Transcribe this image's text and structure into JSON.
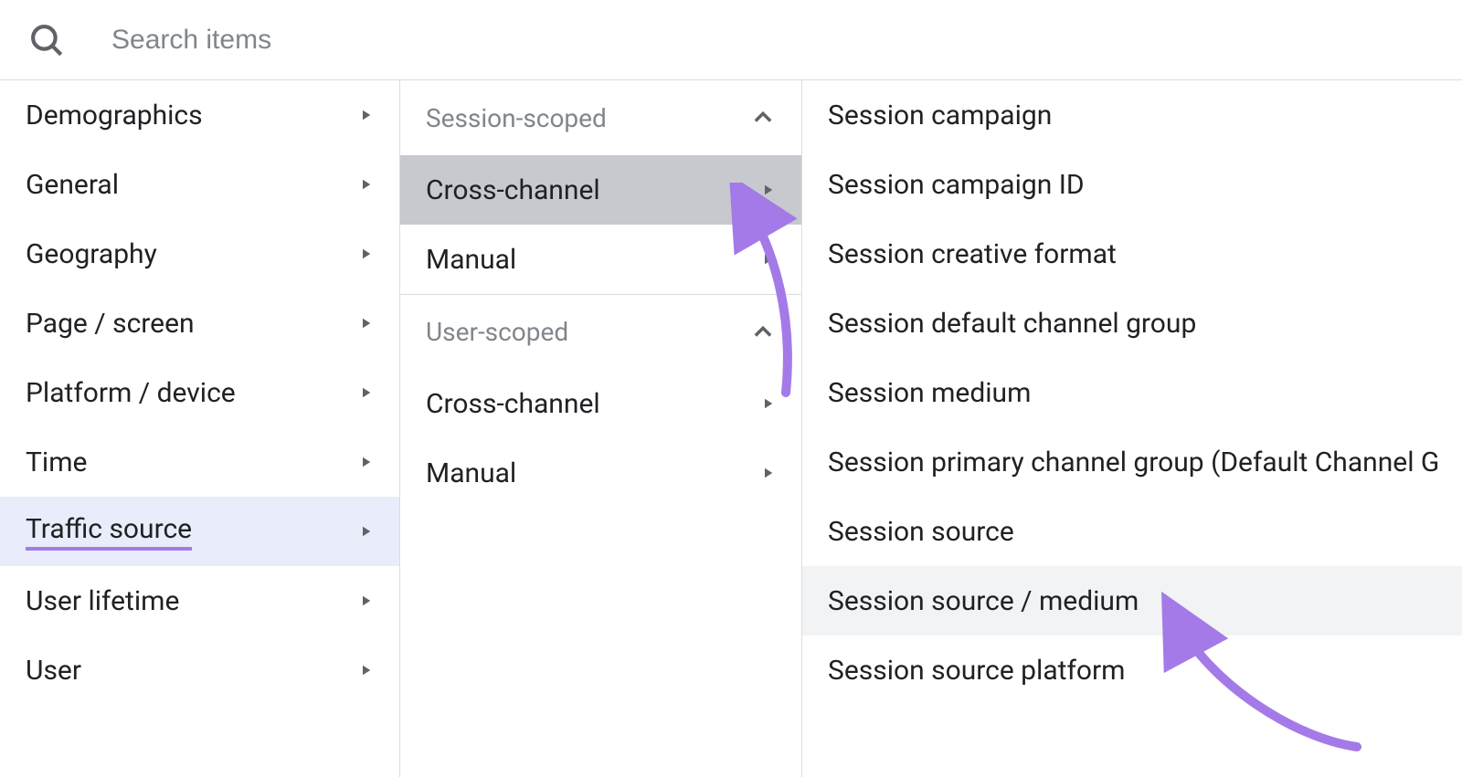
{
  "search": {
    "placeholder": "Search items"
  },
  "col1": {
    "items": [
      {
        "label": "Demographics",
        "selected": false
      },
      {
        "label": "General",
        "selected": false
      },
      {
        "label": "Geography",
        "selected": false
      },
      {
        "label": "Page / screen",
        "selected": false
      },
      {
        "label": "Platform / device",
        "selected": false
      },
      {
        "label": "Time",
        "selected": false
      },
      {
        "label": "Traffic source",
        "selected": true
      },
      {
        "label": "User lifetime",
        "selected": false
      },
      {
        "label": "User",
        "selected": false
      }
    ]
  },
  "col2": {
    "groups": [
      {
        "title": "Session-scoped",
        "items": [
          {
            "label": "Cross-channel",
            "selected": true
          },
          {
            "label": "Manual",
            "selected": false
          }
        ]
      },
      {
        "title": "User-scoped",
        "items": [
          {
            "label": "Cross-channel",
            "selected": false
          },
          {
            "label": "Manual",
            "selected": false
          }
        ]
      }
    ]
  },
  "col3": {
    "items": [
      {
        "label": "Session campaign",
        "hover": false
      },
      {
        "label": "Session campaign ID",
        "hover": false
      },
      {
        "label": "Session creative format",
        "hover": false
      },
      {
        "label": "Session default channel group",
        "hover": false
      },
      {
        "label": "Session medium",
        "hover": false
      },
      {
        "label": "Session primary channel group (Default Channel Group)",
        "hover": false
      },
      {
        "label": "Session source",
        "hover": false
      },
      {
        "label": "Session source / medium",
        "hover": true
      },
      {
        "label": "Session source platform",
        "hover": false
      }
    ]
  },
  "annotation_color": "#a47ae8"
}
